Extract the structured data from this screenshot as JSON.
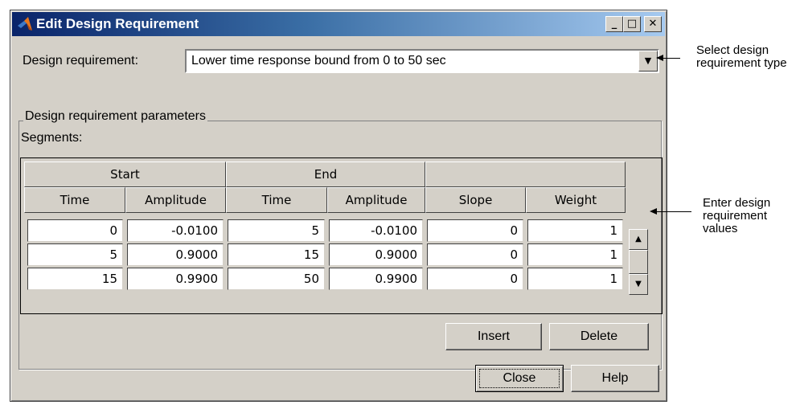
{
  "window": {
    "title": "Edit Design Requirement",
    "minimize": "_",
    "maximize": "□",
    "close": "✕"
  },
  "design_requirement": {
    "label": "Design requirement:",
    "selected": "Lower time response bound from 0 to 50 sec"
  },
  "parameters": {
    "group_title": "Design requirement parameters",
    "segments_label": "Segments:"
  },
  "table": {
    "group_headers": [
      "Start",
      "End",
      ""
    ],
    "column_headers": [
      "Time",
      "Amplitude",
      "Time",
      "Amplitude",
      "Slope",
      "Weight"
    ],
    "rows": [
      [
        "0",
        "-0.0100",
        "5",
        "-0.0100",
        "0",
        "1"
      ],
      [
        "5",
        "0.9000",
        "15",
        "0.9000",
        "0",
        "1"
      ],
      [
        "15",
        "0.9900",
        "50",
        "0.9900",
        "0",
        "1"
      ]
    ]
  },
  "buttons": {
    "insert": "Insert",
    "delete": "Delete",
    "close": "Close",
    "help": "Help"
  },
  "annotations": {
    "select_type": "Select design requirement type",
    "enter_values": "Enter design requirement values"
  },
  "icons": {
    "app": "matlab-logo-icon",
    "dropdown": "chevron-down-icon",
    "scroll_up": "scroll-up-icon",
    "scroll_down": "scroll-down-icon"
  }
}
